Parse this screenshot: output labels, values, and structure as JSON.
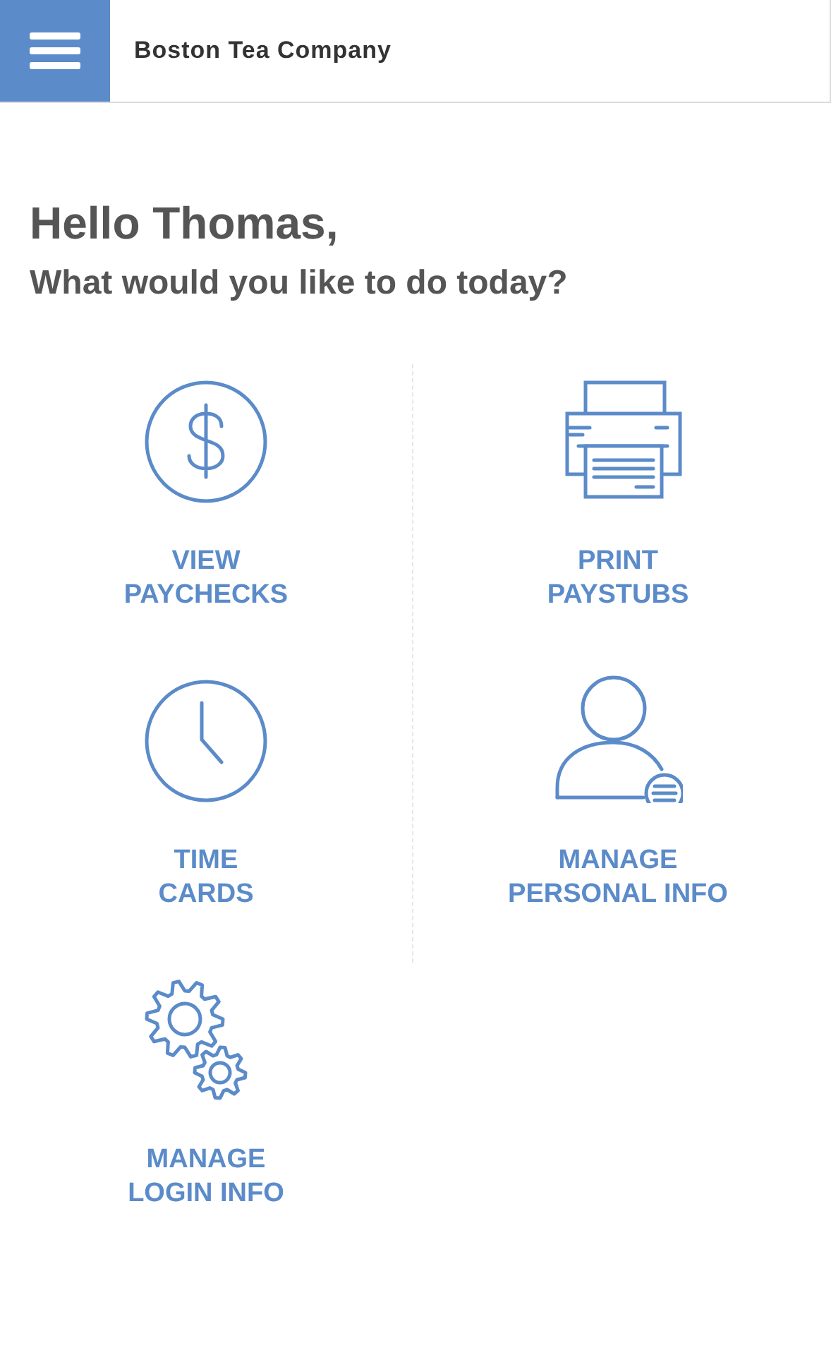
{
  "header": {
    "title": "Boston Tea Company"
  },
  "greeting": {
    "title": "Hello Thomas,",
    "subtitle": "What would you like to do today?"
  },
  "tiles": [
    {
      "kind": "paychecks",
      "label": "VIEW\nPAYCHECKS"
    },
    {
      "kind": "paystubs",
      "label": "PRINT\nPAYSTUBS"
    },
    {
      "kind": "timecards",
      "label": "TIME\nCARDS"
    },
    {
      "kind": "personal",
      "label": "MANAGE\nPERSONAL INFO"
    },
    {
      "kind": "login",
      "label": "MANAGE\nLOGIN INFO"
    }
  ]
}
